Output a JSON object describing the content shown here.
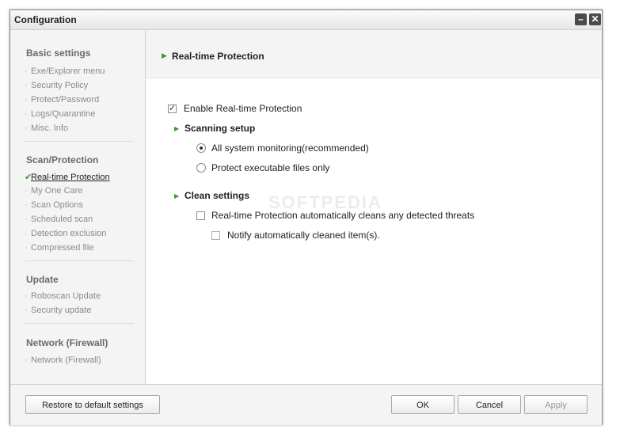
{
  "window": {
    "title": "Configuration",
    "minimize_glyph": "–",
    "close_glyph": "✕"
  },
  "sidebar": {
    "groups": [
      {
        "title": "Basic settings",
        "items": [
          "Exe/Explorer menu",
          "Security Policy",
          "Protect/Password",
          "Logs/Quarantine",
          "Misc. Info"
        ]
      },
      {
        "title": "Scan/Protection",
        "items": [
          "Real-time Protection",
          "My One Care",
          "Scan Options",
          "Scheduled scan",
          "Detection exclusion",
          "Compressed file"
        ]
      },
      {
        "title": "Update",
        "items": [
          "Roboscan Update",
          "Security update"
        ]
      },
      {
        "title": "Network (Firewall)",
        "items": [
          "Network (Firewall)"
        ]
      }
    ],
    "active_item": "Real-time Protection"
  },
  "content": {
    "header_title": "Real-time Protection",
    "enable_label": "Enable Real-time Protection",
    "enable_checked": true,
    "scanning_setup": {
      "title": "Scanning setup",
      "options": [
        {
          "label": "All system monitoring(recommended)",
          "selected": true
        },
        {
          "label": "Protect executable files only",
          "selected": false
        }
      ]
    },
    "clean_settings": {
      "title": "Clean settings",
      "auto_clean_label": "Real-time Protection automatically cleans any detected threats",
      "auto_clean_checked": false,
      "notify_label": "Notify automatically cleaned item(s).",
      "notify_checked": false
    }
  },
  "footer": {
    "restore_label": "Restore to default settings",
    "ok_label": "OK",
    "cancel_label": "Cancel",
    "apply_label": "Apply",
    "apply_enabled": false
  },
  "watermark": "SOFTPEDIA",
  "colors": {
    "accent_green": "#3a9a2a",
    "sidebar_bg": "#f4f4f4",
    "content_bg": "#ffffff"
  }
}
